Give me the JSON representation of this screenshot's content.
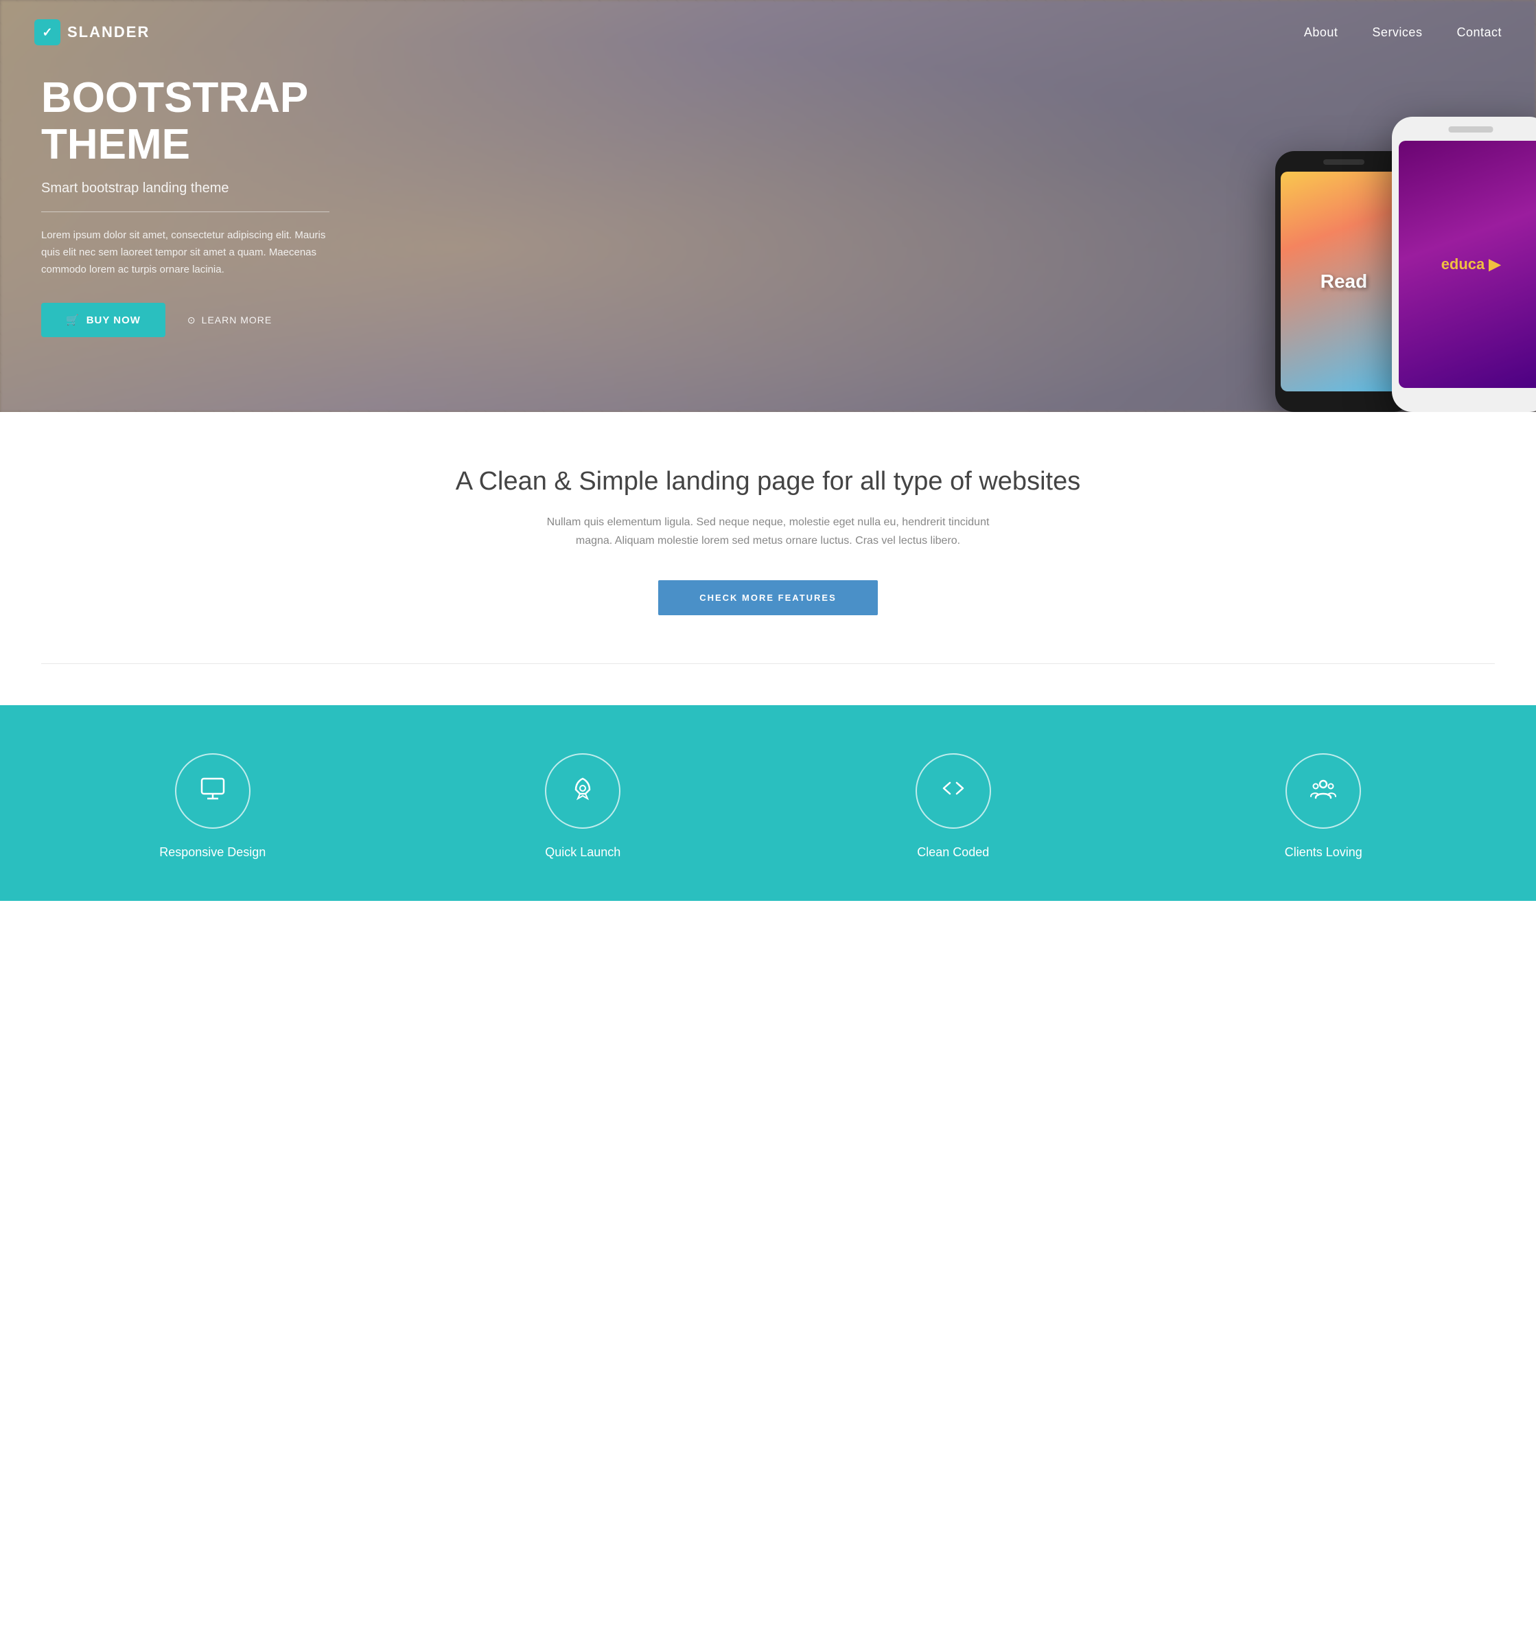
{
  "nav": {
    "logo_icon": "/",
    "logo_text": "SLANDER",
    "links": [
      {
        "label": "About",
        "href": "#about"
      },
      {
        "label": "Services",
        "href": "#services"
      },
      {
        "label": "Contact",
        "href": "#contact"
      }
    ]
  },
  "hero": {
    "title": "BOOTSTRAP THEME",
    "subtitle": "Smart bootstrap landing theme",
    "body": "Lorem ipsum dolor sit amet, consectetur adipiscing elit. Mauris quis elit nec sem laoreet tempor sit amet a quam. Maecenas commodo lorem ac turpis ornare lacinia.",
    "btn_buy": "BUY NOW",
    "btn_learn": "LEARN MORE",
    "phone_black_label": "Read",
    "phone_white_label": "educa ▶"
  },
  "mid": {
    "title": "A Clean & Simple landing page for all type of websites",
    "body": "Nullam quis elementum ligula. Sed neque neque, molestie eget nulla eu, hendrerit tincidunt magna. Aliquam molestie lorem sed metus ornare luctus. Cras vel lectus libero.",
    "btn_features": "CHECK MORE FEATURES"
  },
  "features": [
    {
      "label": "Responsive Design",
      "icon": "monitor"
    },
    {
      "label": "Quick Launch",
      "icon": "rocket"
    },
    {
      "label": "Clean Coded",
      "icon": "code"
    },
    {
      "label": "Clients Loving",
      "icon": "users"
    }
  ],
  "colors": {
    "teal": "#2abfbf",
    "blue": "#4a90c8",
    "dark": "#333333"
  }
}
